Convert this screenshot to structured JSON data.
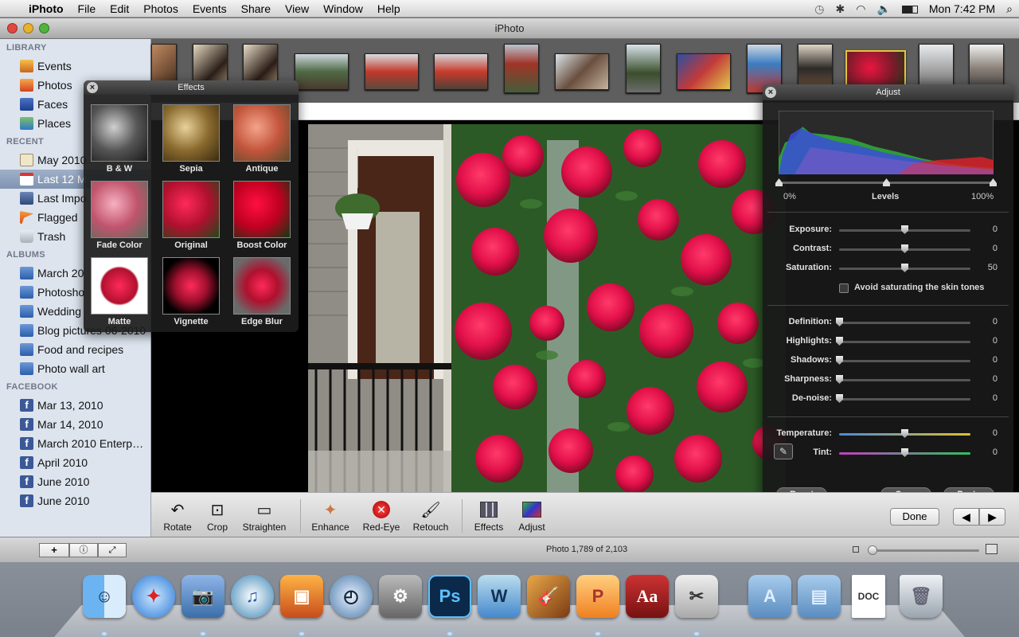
{
  "menubar": {
    "app_name": "iPhoto",
    "items": [
      "File",
      "Edit",
      "Photos",
      "Events",
      "Share",
      "View",
      "Window",
      "Help"
    ],
    "clock": "Mon 7:42 PM"
  },
  "window": {
    "title": "iPhoto"
  },
  "sidebar": {
    "library_header": "LIBRARY",
    "library": [
      {
        "label": "Events",
        "icon": "events-icon"
      },
      {
        "label": "Photos",
        "icon": "photos-icon"
      },
      {
        "label": "Faces",
        "icon": "faces-icon"
      },
      {
        "label": "Places",
        "icon": "places-icon"
      }
    ],
    "recent_header": "RECENT",
    "recent": [
      {
        "label": "May 2010",
        "icon": "event-icon"
      },
      {
        "label": "Last 12 M",
        "icon": "calendar-icon"
      },
      {
        "label": "Last Impo",
        "icon": "import-icon"
      },
      {
        "label": "Flagged",
        "icon": "flag-icon"
      },
      {
        "label": "Trash",
        "icon": "trash-icon"
      }
    ],
    "albums_header": "ALBUMS",
    "albums": [
      {
        "label": "March 20"
      },
      {
        "label": "Photosho"
      },
      {
        "label": "Wedding"
      },
      {
        "label": "Blog pictures 06-2010"
      },
      {
        "label": "Food and recipes"
      },
      {
        "label": "Photo wall art"
      }
    ],
    "facebook_header": "FACEBOOK",
    "facebook": [
      {
        "label": "Mar 13, 2010"
      },
      {
        "label": "Mar 14, 2010"
      },
      {
        "label": "March 2010 Enterp…"
      },
      {
        "label": "April 2010"
      },
      {
        "label": "June 2010"
      },
      {
        "label": "June 2010"
      }
    ]
  },
  "effects_panel": {
    "title": "Effects",
    "items": [
      "B & W",
      "Sepia",
      "Antique",
      "Fade Color",
      "Original",
      "Boost Color",
      "Matte",
      "Vignette",
      "Edge Blur"
    ]
  },
  "adjust_panel": {
    "title": "Adjust",
    "levels_label": "Levels",
    "levels_min": "0%",
    "levels_max": "100%",
    "sliders_a": [
      {
        "label": "Exposure:",
        "value": "0",
        "pos": 0.5
      },
      {
        "label": "Contrast:",
        "value": "0",
        "pos": 0.5
      },
      {
        "label": "Saturation:",
        "value": "50",
        "pos": 0.5
      }
    ],
    "skin_tones_label": "Avoid saturating the skin tones",
    "sliders_b": [
      {
        "label": "Definition:",
        "value": "0",
        "pos": 0
      },
      {
        "label": "Highlights:",
        "value": "0",
        "pos": 0
      },
      {
        "label": "Shadows:",
        "value": "0",
        "pos": 0
      },
      {
        "label": "Sharpness:",
        "value": "0",
        "pos": 0
      },
      {
        "label": "De-noise:",
        "value": "0",
        "pos": 0
      }
    ],
    "sliders_c": [
      {
        "label": "Temperature:",
        "value": "0",
        "pos": 0.5
      },
      {
        "label": "Tint:",
        "value": "0",
        "pos": 0.5
      }
    ],
    "reset": "Reset",
    "copy": "Copy",
    "paste": "Paste"
  },
  "toolbar": {
    "tools": [
      "Rotate",
      "Crop",
      "Straighten",
      "Enhance",
      "Red-Eye",
      "Retouch",
      "Effects",
      "Adjust"
    ],
    "done": "Done"
  },
  "status": {
    "photo_count": "Photo 1,789 of 2,103"
  },
  "dock": {
    "apps": [
      "Finder",
      "Safari",
      "iPhoto",
      "iTunes",
      "Image Capture",
      "Time Machine",
      "System Preferences",
      "Photoshop",
      "Word",
      "GarageBand",
      "PowerPoint",
      "Dictionary",
      "Scissors",
      "Applications",
      "Documents",
      "Document",
      "Trash"
    ]
  }
}
